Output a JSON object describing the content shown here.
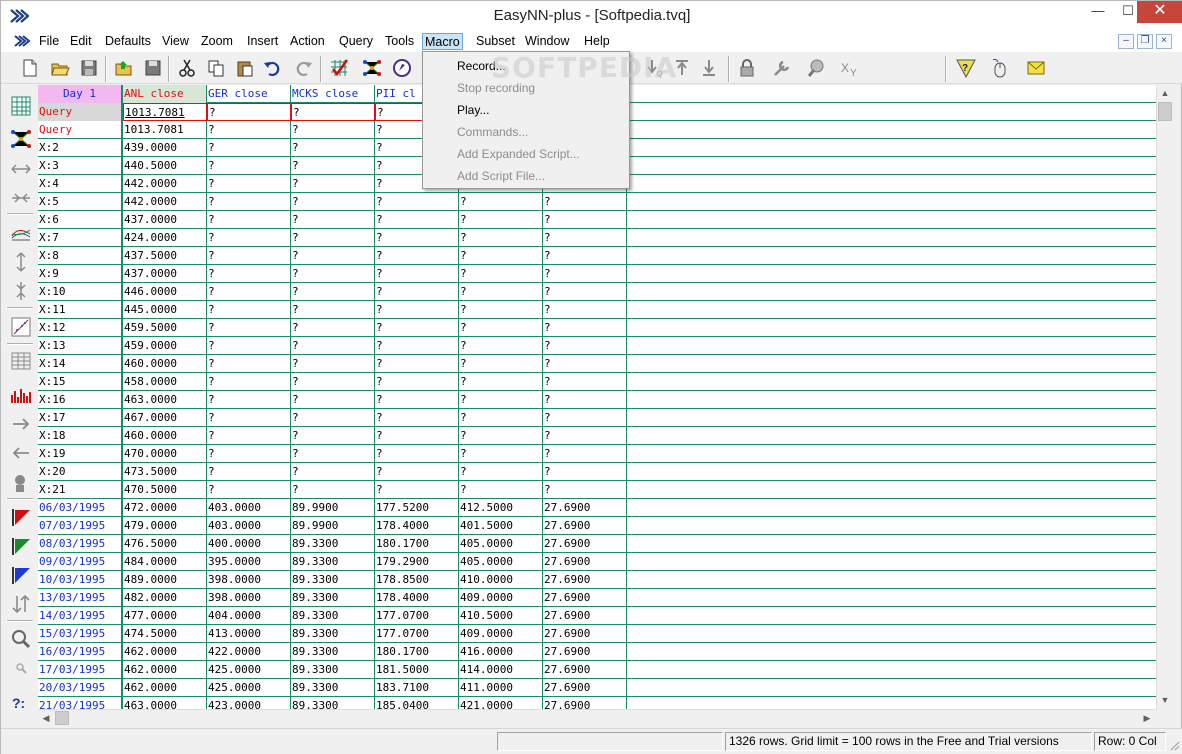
{
  "window": {
    "title": "EasyNN-plus - [Softpedia.tvq]",
    "min_glyph": "—",
    "max_glyph": "☐",
    "close_glyph": "✕",
    "app_icon": "easynn-logo-icon"
  },
  "menubar": {
    "items": [
      "File",
      "Edit",
      "Defaults",
      "View",
      "Zoom",
      "Insert",
      "Action",
      "Query",
      "Tools",
      "Macro",
      "Subset",
      "Window",
      "Help"
    ],
    "active": "Macro",
    "mdi_min": "–",
    "mdi_restore": "❐",
    "mdi_close": "×"
  },
  "macro_menu": {
    "items": [
      {
        "label": "Record...",
        "enabled": true
      },
      {
        "label": "Stop recording",
        "enabled": false
      },
      {
        "label": "Play...",
        "enabled": true
      },
      {
        "label": "Commands...",
        "enabled": false
      },
      {
        "label": "Add Expanded Script...",
        "enabled": false
      },
      {
        "label": "Add Script File...",
        "enabled": false
      }
    ]
  },
  "watermark": "SOFTPEDIA",
  "grid": {
    "columns": [
      "Day 1",
      "ANL close",
      "GER close",
      "MCKS close",
      "PII cl",
      "",
      ""
    ],
    "rows": [
      {
        "label": "Query",
        "kind": "query",
        "cells": [
          "1013.7081",
          "?",
          "?",
          "?",
          "",
          ""
        ]
      },
      {
        "label": "Query",
        "kind": "query",
        "cells": [
          "1013.7081",
          "?",
          "?",
          "?",
          "",
          ""
        ]
      },
      {
        "label": "X:2",
        "kind": "x",
        "cells": [
          "439.0000",
          "?",
          "?",
          "?",
          "",
          ""
        ]
      },
      {
        "label": "X:3",
        "kind": "x",
        "cells": [
          "440.5000",
          "?",
          "?",
          "?",
          "",
          ""
        ]
      },
      {
        "label": "X:4",
        "kind": "x",
        "cells": [
          "442.0000",
          "?",
          "?",
          "?",
          "",
          ""
        ]
      },
      {
        "label": "X:5",
        "kind": "x",
        "cells": [
          "442.0000",
          "?",
          "?",
          "?",
          "?",
          "?"
        ]
      },
      {
        "label": "X:6",
        "kind": "x",
        "cells": [
          "437.0000",
          "?",
          "?",
          "?",
          "?",
          "?"
        ]
      },
      {
        "label": "X:7",
        "kind": "x",
        "cells": [
          "424.0000",
          "?",
          "?",
          "?",
          "?",
          "?"
        ]
      },
      {
        "label": "X:8",
        "kind": "x",
        "cells": [
          "437.5000",
          "?",
          "?",
          "?",
          "?",
          "?"
        ]
      },
      {
        "label": "X:9",
        "kind": "x",
        "cells": [
          "437.0000",
          "?",
          "?",
          "?",
          "?",
          "?"
        ]
      },
      {
        "label": "X:10",
        "kind": "x",
        "cells": [
          "446.0000",
          "?",
          "?",
          "?",
          "?",
          "?"
        ]
      },
      {
        "label": "X:11",
        "kind": "x",
        "cells": [
          "445.0000",
          "?",
          "?",
          "?",
          "?",
          "?"
        ]
      },
      {
        "label": "X:12",
        "kind": "x",
        "cells": [
          "459.5000",
          "?",
          "?",
          "?",
          "?",
          "?"
        ]
      },
      {
        "label": "X:13",
        "kind": "x",
        "cells": [
          "459.0000",
          "?",
          "?",
          "?",
          "?",
          "?"
        ]
      },
      {
        "label": "X:14",
        "kind": "x",
        "cells": [
          "460.0000",
          "?",
          "?",
          "?",
          "?",
          "?"
        ]
      },
      {
        "label": "X:15",
        "kind": "x",
        "cells": [
          "458.0000",
          "?",
          "?",
          "?",
          "?",
          "?"
        ]
      },
      {
        "label": "X:16",
        "kind": "x",
        "cells": [
          "463.0000",
          "?",
          "?",
          "?",
          "?",
          "?"
        ]
      },
      {
        "label": "X:17",
        "kind": "x",
        "cells": [
          "467.0000",
          "?",
          "?",
          "?",
          "?",
          "?"
        ]
      },
      {
        "label": "X:18",
        "kind": "x",
        "cells": [
          "460.0000",
          "?",
          "?",
          "?",
          "?",
          "?"
        ]
      },
      {
        "label": "X:19",
        "kind": "x",
        "cells": [
          "470.0000",
          "?",
          "?",
          "?",
          "?",
          "?"
        ]
      },
      {
        "label": "X:20",
        "kind": "x",
        "cells": [
          "473.5000",
          "?",
          "?",
          "?",
          "?",
          "?"
        ]
      },
      {
        "label": "X:21",
        "kind": "x",
        "cells": [
          "470.5000",
          "?",
          "?",
          "?",
          "?",
          "?"
        ]
      },
      {
        "label": "06/03/1995",
        "kind": "date",
        "cells": [
          "472.0000",
          "403.0000",
          "89.9900",
          "177.5200",
          "412.5000",
          "27.6900"
        ]
      },
      {
        "label": "07/03/1995",
        "kind": "date",
        "cells": [
          "479.0000",
          "403.0000",
          "89.9900",
          "178.4000",
          "401.5000",
          "27.6900"
        ]
      },
      {
        "label": "08/03/1995",
        "kind": "date",
        "cells": [
          "476.5000",
          "400.0000",
          "89.3300",
          "180.1700",
          "405.0000",
          "27.6900"
        ]
      },
      {
        "label": "09/03/1995",
        "kind": "date",
        "cells": [
          "484.0000",
          "395.0000",
          "89.3300",
          "179.2900",
          "405.0000",
          "27.6900"
        ]
      },
      {
        "label": "10/03/1995",
        "kind": "date",
        "cells": [
          "489.0000",
          "398.0000",
          "89.3300",
          "178.8500",
          "410.0000",
          "27.6900"
        ]
      },
      {
        "label": "13/03/1995",
        "kind": "date",
        "cells": [
          "482.0000",
          "398.0000",
          "89.3300",
          "178.4000",
          "409.0000",
          "27.6900"
        ]
      },
      {
        "label": "14/03/1995",
        "kind": "date",
        "cells": [
          "477.0000",
          "404.0000",
          "89.3300",
          "177.0700",
          "410.5000",
          "27.6900"
        ]
      },
      {
        "label": "15/03/1995",
        "kind": "date",
        "cells": [
          "474.5000",
          "413.0000",
          "89.3300",
          "177.0700",
          "409.0000",
          "27.6900"
        ]
      },
      {
        "label": "16/03/1995",
        "kind": "date",
        "cells": [
          "462.0000",
          "422.0000",
          "89.3300",
          "180.1700",
          "416.0000",
          "27.6900"
        ]
      },
      {
        "label": "17/03/1995",
        "kind": "date",
        "cells": [
          "462.0000",
          "425.0000",
          "89.3300",
          "181.5000",
          "414.0000",
          "27.6900"
        ]
      },
      {
        "label": "20/03/1995",
        "kind": "date",
        "cells": [
          "462.0000",
          "425.0000",
          "89.3300",
          "183.7100",
          "411.0000",
          "27.6900"
        ]
      },
      {
        "label": "21/03/1995",
        "kind": "date",
        "cells": [
          "463.0000",
          "423.0000",
          "89.3300",
          "185.0400",
          "421.0000",
          "27.6900"
        ]
      }
    ]
  },
  "statusbar": {
    "info": "1326 rows. Grid limit = 100 rows in the Free and Trial versions",
    "position": "Row: 0  Col"
  },
  "colors": {
    "grid_line": "#1a8a6a",
    "query_text": "#e01010",
    "date_text": "#1030d0",
    "day_header_bg": "#f4b8f0"
  }
}
